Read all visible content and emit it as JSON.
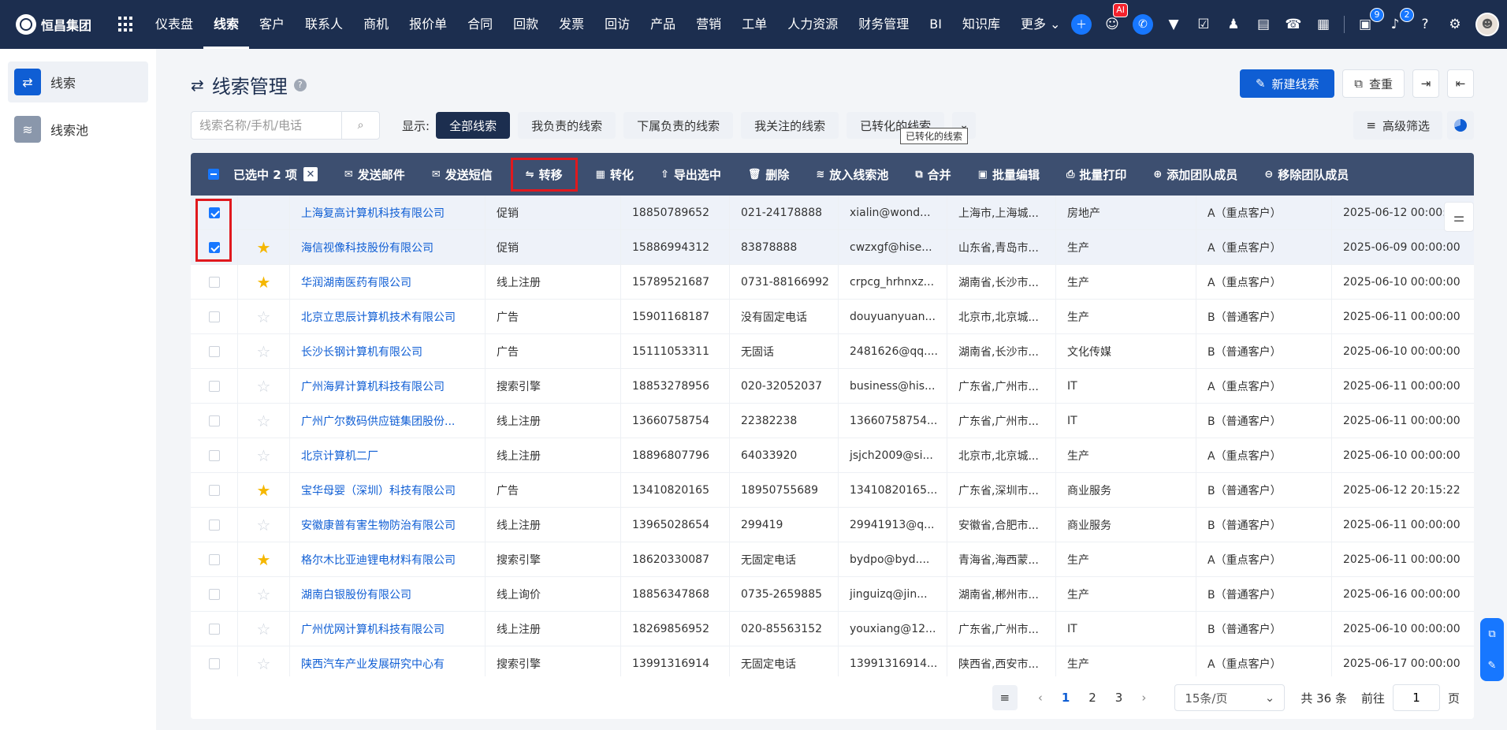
{
  "topnav": {
    "logo_text": "恒昌集团",
    "menu": [
      "仪表盘",
      "线索",
      "客户",
      "联系人",
      "商机",
      "报价单",
      "合同",
      "回款",
      "发票",
      "回访",
      "产品",
      "营销",
      "工单",
      "人力资源",
      "财务管理",
      "BI",
      "知识库",
      "更多"
    ],
    "ai_badge": "AI",
    "tasks_badge": "9",
    "notice_badge": "2"
  },
  "sidebar": {
    "items": [
      {
        "label": "线索",
        "icon": "leads-icon"
      },
      {
        "label": "线索池",
        "icon": "pool-icon"
      }
    ]
  },
  "page": {
    "title": "线索管理",
    "new_button": "新建线索",
    "dedupe_button": "查重"
  },
  "filters": {
    "search_placeholder": "线索名称/手机/电话",
    "show_label": "显示:",
    "chips": [
      "全部线索",
      "我负责的线索",
      "下属负责的线索",
      "我关注的线索",
      "已转化的线索"
    ],
    "tooltip": "已转化的线索",
    "advanced": "高级筛选"
  },
  "actionbar": {
    "selected_text": "已选中 2 项",
    "actions": [
      {
        "label": "发送邮件",
        "icon": "✉"
      },
      {
        "label": "发送短信",
        "icon": "✉"
      },
      {
        "label": "转移",
        "icon": "⇋"
      },
      {
        "label": "转化",
        "icon": "▦"
      },
      {
        "label": "导出选中",
        "icon": "⇧"
      },
      {
        "label": "删除",
        "icon": "🗑"
      },
      {
        "label": "放入线索池",
        "icon": "≋"
      },
      {
        "label": "合并",
        "icon": "⧉"
      },
      {
        "label": "批量编辑",
        "icon": "▣"
      },
      {
        "label": "批量打印",
        "icon": "⎙"
      },
      {
        "label": "添加团队成员",
        "icon": "⊕"
      },
      {
        "label": "移除团队成员",
        "icon": "⊖"
      }
    ]
  },
  "rows": [
    {
      "checked": true,
      "starred": null,
      "name": "上海复高计算机科技有限公司",
      "source": "促销",
      "mobile": "18850789652",
      "phone": "021-24178888",
      "email": "xialin@wond...",
      "address": "上海市,上海城...",
      "industry": "房地产",
      "level": "A（重点客户）",
      "time": "2025-06-12 00:00:00"
    },
    {
      "checked": true,
      "starred": true,
      "name": "海信视像科技股份有限公司",
      "source": "促销",
      "mobile": "15886994312",
      "phone": "83878888",
      "email": "cwzxgf@hise...",
      "address": "山东省,青岛市...",
      "industry": "生产",
      "level": "A（重点客户）",
      "time": "2025-06-09 00:00:00"
    },
    {
      "checked": false,
      "starred": true,
      "name": "华润湖南医药有限公司",
      "source": "线上注册",
      "mobile": "15789521687",
      "phone": "0731-88166992",
      "email": "crpcg_hrhnxz...",
      "address": "湖南省,长沙市...",
      "industry": "生产",
      "level": "A（重点客户）",
      "time": "2025-06-10 00:00:00"
    },
    {
      "checked": false,
      "starred": false,
      "name": "北京立思辰计算机技术有限公司",
      "source": "广告",
      "mobile": "15901168187",
      "phone": "没有固定电话",
      "email": "douyuanyuan...",
      "address": "北京市,北京城...",
      "industry": "生产",
      "level": "B（普通客户）",
      "time": "2025-06-11 00:00:00"
    },
    {
      "checked": false,
      "starred": false,
      "name": "长沙长钢计算机有限公司",
      "source": "广告",
      "mobile": "15111053311",
      "phone": "无固话",
      "email": "2481626@qq....",
      "address": "湖南省,长沙市...",
      "industry": "文化传媒",
      "level": "B（普通客户）",
      "time": "2025-06-10 00:00:00"
    },
    {
      "checked": false,
      "starred": false,
      "name": "广州海昇计算机科技有限公司",
      "source": "搜索引擎",
      "mobile": "18853278956",
      "phone": "020-32052037",
      "email": "business@his...",
      "address": "广东省,广州市...",
      "industry": "IT",
      "level": "A（重点客户）",
      "time": "2025-06-11 00:00:00"
    },
    {
      "checked": false,
      "starred": false,
      "name": "广州广尔数码供应链集团股份...",
      "source": "线上注册",
      "mobile": "13660758754",
      "phone": "22382238",
      "email": "13660758754...",
      "address": "广东省,广州市...",
      "industry": "IT",
      "level": "B（普通客户）",
      "time": "2025-06-11 00:00:00"
    },
    {
      "checked": false,
      "starred": false,
      "name": "北京计算机二厂",
      "source": "线上注册",
      "mobile": "18896807796",
      "phone": "64033920",
      "email": "jsjch2009@si...",
      "address": "北京市,北京城...",
      "industry": "生产",
      "level": "A（重点客户）",
      "time": "2025-06-10 00:00:00"
    },
    {
      "checked": false,
      "starred": true,
      "name": "宝华母婴（深圳）科技有限公司",
      "source": "广告",
      "mobile": "13410820165",
      "phone": "18950755689",
      "email": "13410820165...",
      "address": "广东省,深圳市...",
      "industry": "商业服务",
      "level": "B（普通客户）",
      "time": "2025-06-12 20:15:22"
    },
    {
      "checked": false,
      "starred": false,
      "name": "安徽康普有害生物防治有限公司",
      "source": "线上注册",
      "mobile": "13965028654",
      "phone": "299419",
      "email": "29941913@q...",
      "address": "安徽省,合肥市...",
      "industry": "商业服务",
      "level": "B（普通客户）",
      "time": "2025-06-11 00:00:00"
    },
    {
      "checked": false,
      "starred": true,
      "name": "格尔木比亚迪锂电材料有限公司",
      "source": "搜索引擎",
      "mobile": "18620330087",
      "phone": "无固定电话",
      "email": "bydpo@byd....",
      "address": "青海省,海西蒙...",
      "industry": "生产",
      "level": "A（重点客户）",
      "time": "2025-06-11 00:00:00"
    },
    {
      "checked": false,
      "starred": false,
      "name": "湖南白银股份有限公司",
      "source": "线上询价",
      "mobile": "18856347868",
      "phone": "0735-2659885",
      "email": "jinguizq@jin...",
      "address": "湖南省,郴州市...",
      "industry": "生产",
      "level": "B（普通客户）",
      "time": "2025-06-16 00:00:00"
    },
    {
      "checked": false,
      "starred": false,
      "name": "广州优网计算机科技有限公司",
      "source": "线上注册",
      "mobile": "18269856952",
      "phone": "020-85563152",
      "email": "youxiang@12...",
      "address": "广东省,广州市...",
      "industry": "IT",
      "level": "B（普通客户）",
      "time": "2025-06-10 00:00:00"
    },
    {
      "checked": false,
      "starred": false,
      "name": "陕西汽车产业发展研究中心有",
      "source": "搜索引擎",
      "mobile": "13991316914",
      "phone": "无固定电话",
      "email": "13991316914...",
      "address": "陕西省,西安市...",
      "industry": "生产",
      "level": "A（重点客户）",
      "time": "2025-06-17 00:00:00"
    }
  ],
  "pager": {
    "pages": [
      "1",
      "2",
      "3"
    ],
    "page_size": "15条/页",
    "total": "共 36 条",
    "goto_label": "前往",
    "goto_value": "1",
    "page_unit": "页"
  }
}
